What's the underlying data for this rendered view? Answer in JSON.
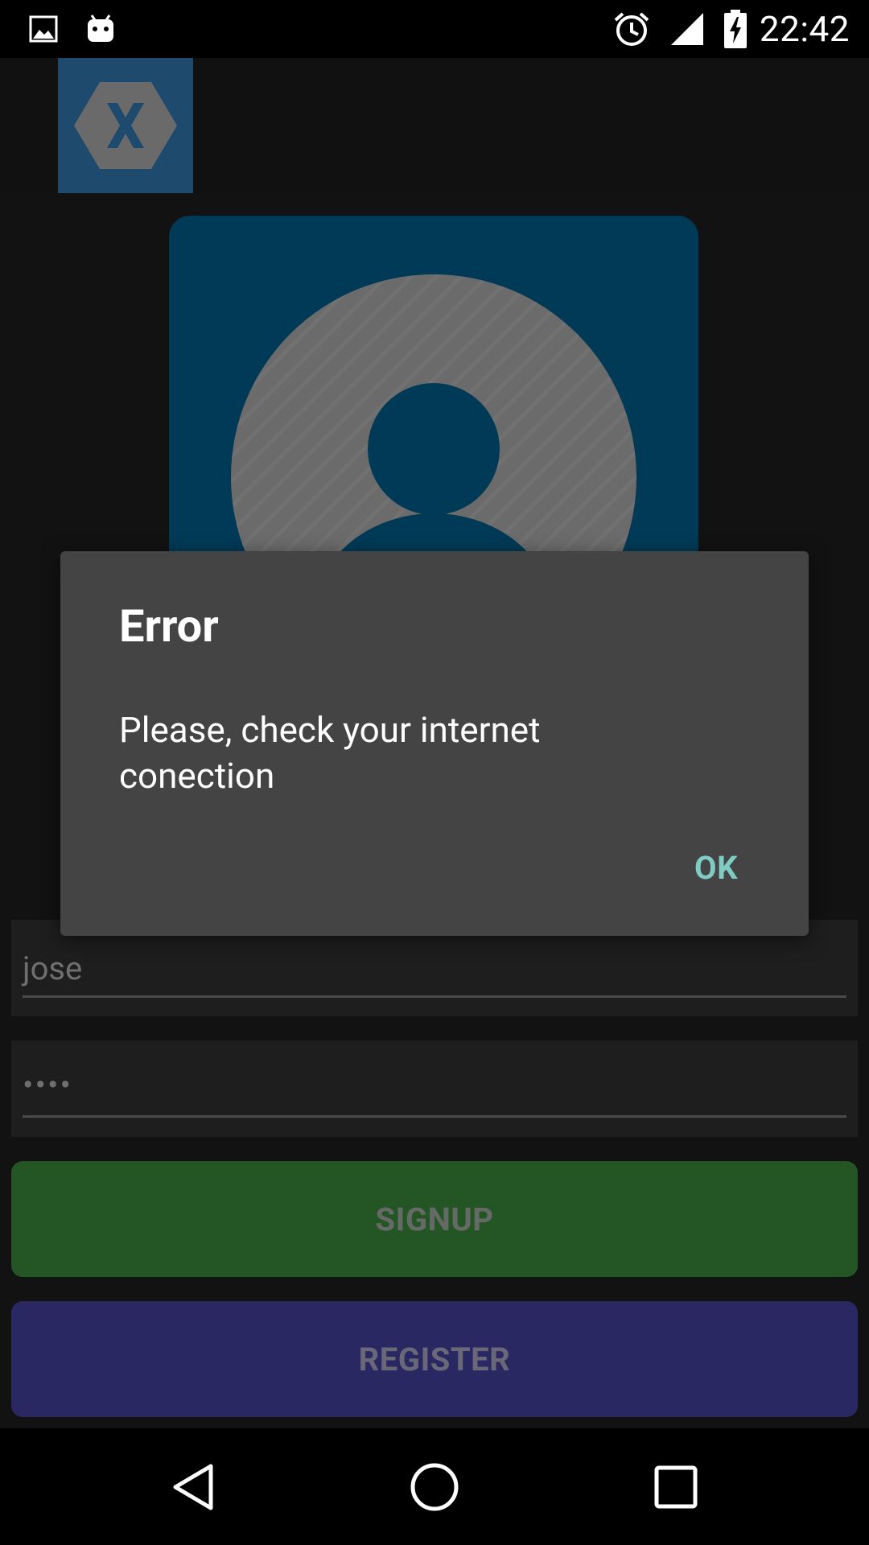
{
  "status_bar": {
    "time": "22:42",
    "icons": [
      "gallery-icon",
      "android-icon",
      "alarm-icon",
      "signal-icon",
      "battery-charging-icon"
    ]
  },
  "toolbar": {
    "logo_icon": "xamarin-logo-icon",
    "logo_color": "#1e4a6e"
  },
  "profile": {
    "avatar_icon": "user-avatar-icon",
    "card_color": "#013a56"
  },
  "form": {
    "username_value": "jose",
    "password_value": "••••"
  },
  "buttons": {
    "signup_label": "SIGNUP",
    "register_label": "REGISTER",
    "signup_color": "#245625",
    "register_color": "#2a2863"
  },
  "dialog": {
    "title": "Error",
    "message": "Please, check your internet conection",
    "ok_label": "OK",
    "ok_color": "#80cbc4"
  },
  "nav_bar": {
    "icons": [
      "back-icon",
      "home-icon",
      "recents-icon"
    ]
  }
}
